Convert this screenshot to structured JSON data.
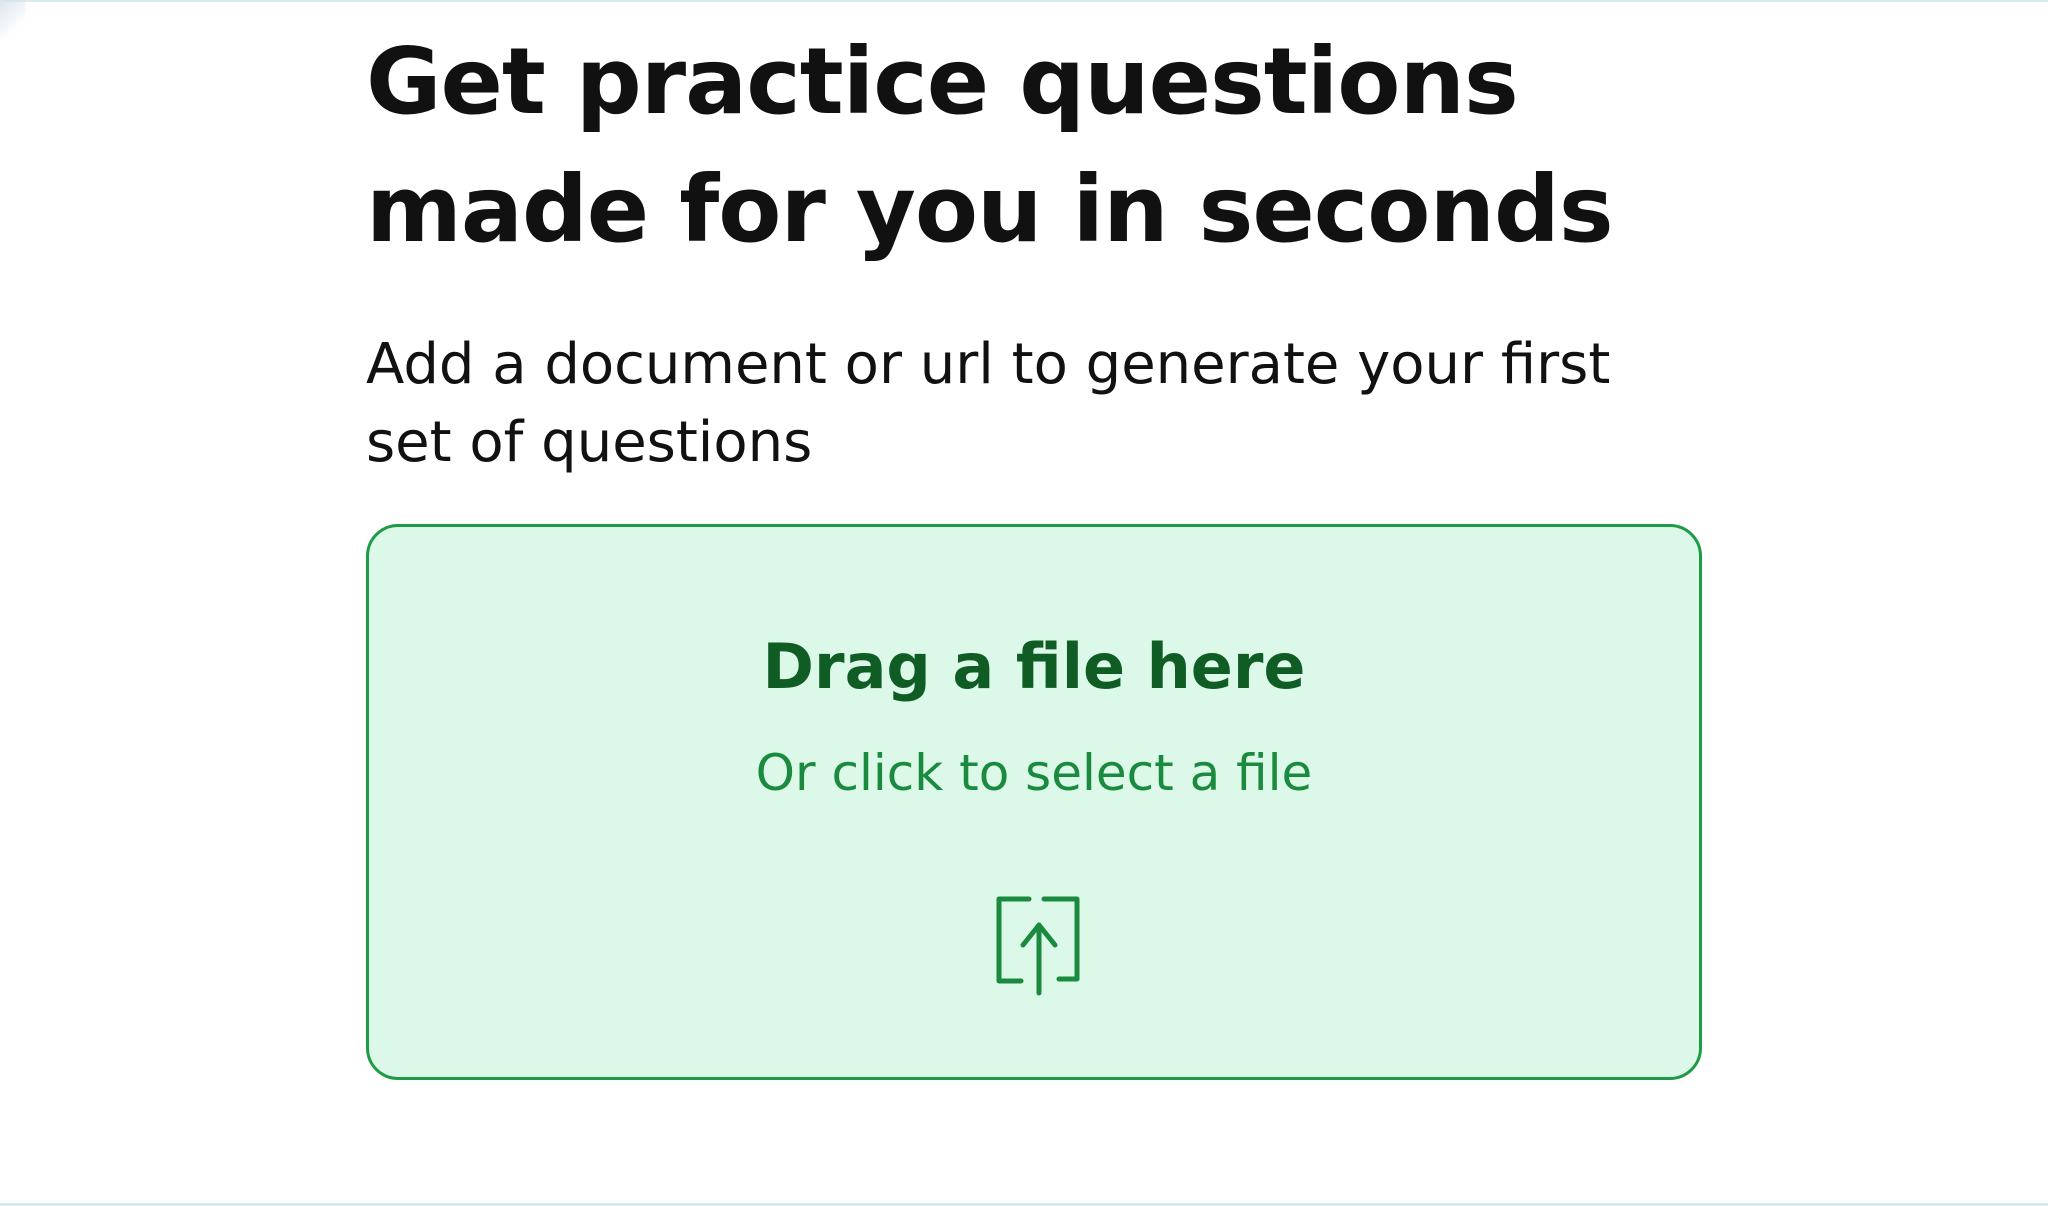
{
  "headline": {
    "line1": "Get practice questions",
    "line2": "made for you in seconds"
  },
  "subheading": "Add a document or url to generate your first set of questions",
  "dropzone": {
    "title": "Drag a file here",
    "subtitle": "Or click to select a file",
    "icon": "upload-icon"
  },
  "colors": {
    "dropzone_background": "#dcf8e8",
    "dropzone_border": "#1e9b46",
    "dropzone_title": "#0f5c25",
    "dropzone_subtitle": "#1a8a3f",
    "text": "#111111"
  }
}
